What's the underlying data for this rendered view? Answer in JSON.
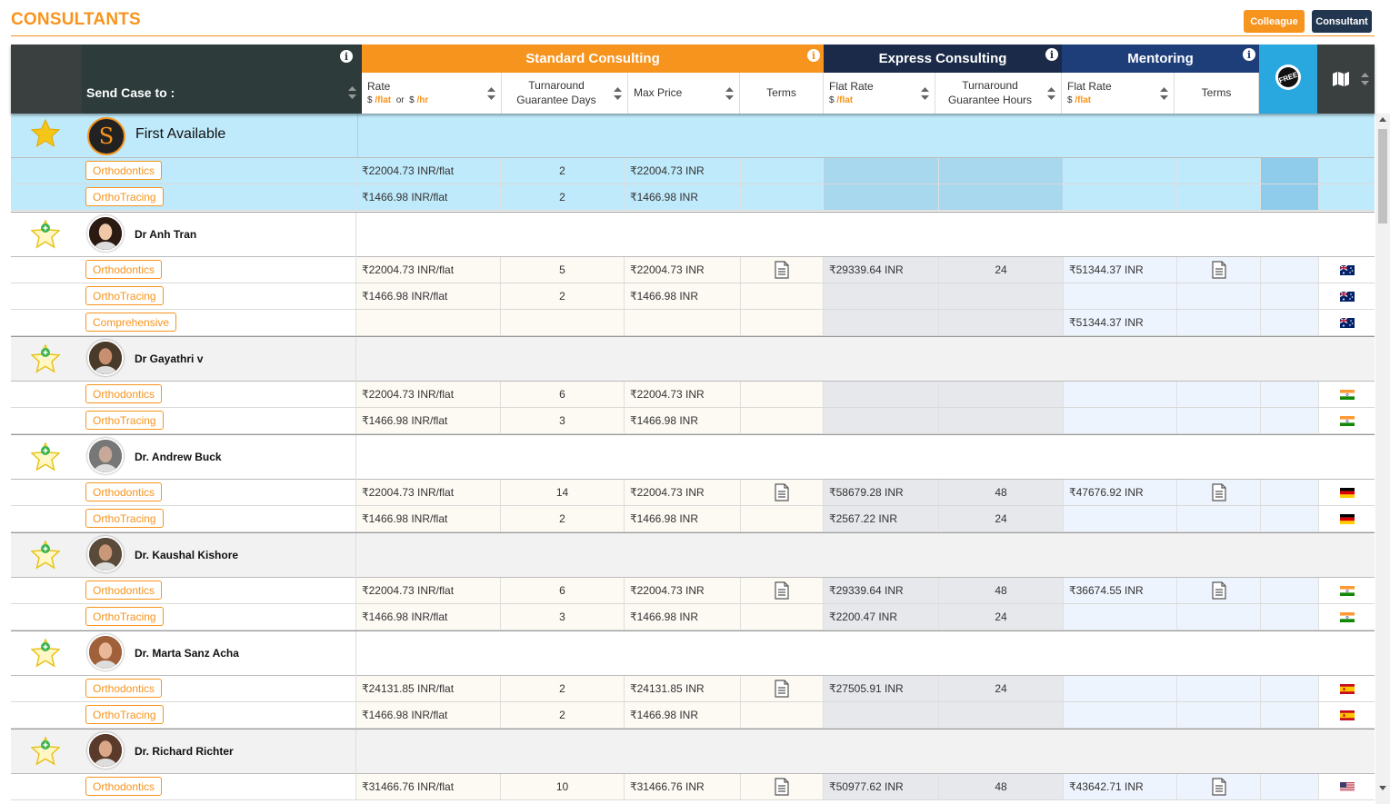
{
  "page": {
    "title": "CONSULTANTS"
  },
  "top_buttons": {
    "colleague": "Colleague",
    "consultant": "Consultant"
  },
  "header": {
    "send_case_to": "Send Case to :",
    "groups": {
      "standard": "Standard Consulting",
      "express": "Express Consulting",
      "mentoring": "Mentoring"
    },
    "cols": {
      "rate": "Rate",
      "rate_unit_currency": "$",
      "rate_unit_flat": "/flat",
      "rate_or": "or",
      "rate_unit_hr": "/hr",
      "turnaround_days_1": "Turnaround",
      "turnaround_days_2": "Guarantee Days",
      "max_price": "Max Price",
      "terms": "Terms",
      "express_flat_rate": "Flat Rate",
      "express_unit_currency": "$",
      "express_unit_flat": "/flat",
      "turnaround_hours_1": "Turnaround",
      "turnaround_hours_2": "Guarantee Hours",
      "mentoring_flat_rate": "Flat Rate",
      "mentoring_unit_currency": "$",
      "mentoring_unit_flat": "/flat",
      "mentoring_terms": "Terms",
      "free_badge": "FREE"
    }
  },
  "first_available": {
    "name": "First Available",
    "logo_letter": "S",
    "rows": [
      {
        "specialty": "Orthodontics",
        "rate": "₹22004.73 INR/flat",
        "days": "2",
        "max": "₹22004.73 INR"
      },
      {
        "specialty": "OrthoTracing",
        "rate": "₹1466.98 INR/flat",
        "days": "2",
        "max": "₹1466.98 INR"
      }
    ]
  },
  "consultants": [
    {
      "name": "Dr Anh Tran",
      "country": "au",
      "rows": [
        {
          "specialty": "Orthodontics",
          "rate": "₹22004.73 INR/flat",
          "days": "5",
          "max": "₹22004.73 INR",
          "terms": true,
          "express": "₹29339.64 INR",
          "hours": "24",
          "mentor": "₹51344.37 INR",
          "mterms": true
        },
        {
          "specialty": "OrthoTracing",
          "rate": "₹1466.98 INR/flat",
          "days": "2",
          "max": "₹1466.98 INR",
          "terms": false,
          "express": "",
          "hours": "",
          "mentor": "",
          "mterms": false
        },
        {
          "specialty": "Comprehensive",
          "rate": "",
          "days": "",
          "max": "",
          "terms": false,
          "express": "",
          "hours": "",
          "mentor": "₹51344.37 INR",
          "mterms": false
        }
      ]
    },
    {
      "name": "Dr Gayathri v",
      "country": "in",
      "rows": [
        {
          "specialty": "Orthodontics",
          "rate": "₹22004.73 INR/flat",
          "days": "6",
          "max": "₹22004.73 INR",
          "terms": false,
          "express": "",
          "hours": "",
          "mentor": "",
          "mterms": false
        },
        {
          "specialty": "OrthoTracing",
          "rate": "₹1466.98 INR/flat",
          "days": "3",
          "max": "₹1466.98 INR",
          "terms": false,
          "express": "",
          "hours": "",
          "mentor": "",
          "mterms": false
        }
      ]
    },
    {
      "name": "Dr. Andrew Buck",
      "country": "de",
      "rows": [
        {
          "specialty": "Orthodontics",
          "rate": "₹22004.73 INR/flat",
          "days": "14",
          "max": "₹22004.73 INR",
          "terms": true,
          "express": "₹58679.28 INR",
          "hours": "48",
          "mentor": "₹47676.92 INR",
          "mterms": true
        },
        {
          "specialty": "OrthoTracing",
          "rate": "₹1466.98 INR/flat",
          "days": "2",
          "max": "₹1466.98 INR",
          "terms": false,
          "express": "₹2567.22 INR",
          "hours": "24",
          "mentor": "",
          "mterms": false
        }
      ]
    },
    {
      "name": "Dr. Kaushal Kishore",
      "country": "in",
      "rows": [
        {
          "specialty": "Orthodontics",
          "rate": "₹22004.73 INR/flat",
          "days": "6",
          "max": "₹22004.73 INR",
          "terms": true,
          "express": "₹29339.64 INR",
          "hours": "48",
          "mentor": "₹36674.55 INR",
          "mterms": true
        },
        {
          "specialty": "OrthoTracing",
          "rate": "₹1466.98 INR/flat",
          "days": "3",
          "max": "₹1466.98 INR",
          "terms": false,
          "express": "₹2200.47 INR",
          "hours": "24",
          "mentor": "",
          "mterms": false
        }
      ]
    },
    {
      "name": "Dr. Marta Sanz Acha",
      "country": "es",
      "rows": [
        {
          "specialty": "Orthodontics",
          "rate": "₹24131.85 INR/flat",
          "days": "2",
          "max": "₹24131.85 INR",
          "terms": true,
          "express": "₹27505.91 INR",
          "hours": "24",
          "mentor": "",
          "mterms": false
        },
        {
          "specialty": "OrthoTracing",
          "rate": "₹1466.98 INR/flat",
          "days": "2",
          "max": "₹1466.98 INR",
          "terms": false,
          "express": "",
          "hours": "",
          "mentor": "",
          "mterms": false
        }
      ]
    },
    {
      "name": "Dr. Richard Richter",
      "country": "us",
      "rows": [
        {
          "specialty": "Orthodontics",
          "rate": "₹31466.76 INR/flat",
          "days": "10",
          "max": "₹31466.76 INR",
          "terms": true,
          "express": "₹50977.62 INR",
          "hours": "48",
          "mentor": "₹43642.71 INR",
          "mterms": true
        }
      ]
    }
  ],
  "colors": {
    "accent": "#f7941d",
    "dark_header": "#2d3b3b",
    "express_header": "#1a2a48",
    "mentoring_header": "#1e3e7a",
    "free_col": "#29a8e0",
    "first_available_bg": "#bfeafb"
  },
  "icons": {
    "star": "star-icon",
    "info": "info-icon",
    "sort": "sort-icon",
    "terms": "document-icon",
    "map": "map-icon",
    "free": "free-badge-icon"
  }
}
